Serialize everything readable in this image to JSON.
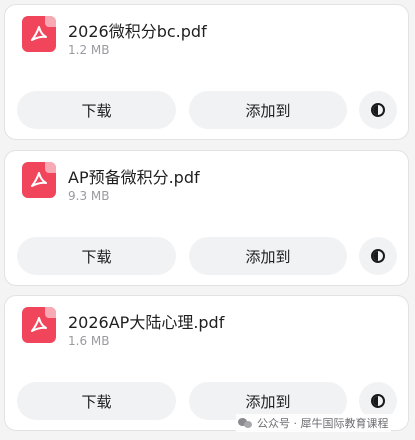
{
  "files": [
    {
      "name": "2026微积分bc.pdf",
      "size": "1.2 MB",
      "download_label": "下载",
      "add_label": "添加到",
      "icon": "pdf-icon"
    },
    {
      "name": "AP预备微积分.pdf",
      "size": "9.3 MB",
      "download_label": "下载",
      "add_label": "添加到",
      "icon": "pdf-icon"
    },
    {
      "name": "2026AP大陆心理.pdf",
      "size": "1.6 MB",
      "download_label": "下载",
      "add_label": "添加到",
      "icon": "pdf-icon"
    }
  ],
  "watermark": {
    "text": "公众号 · 犀牛国际教育课程"
  },
  "colors": {
    "pdf_icon": "#f0455b",
    "button_bg": "#f1f2f4",
    "card_bg": "#ffffff",
    "page_bg": "#f4f4f5"
  }
}
